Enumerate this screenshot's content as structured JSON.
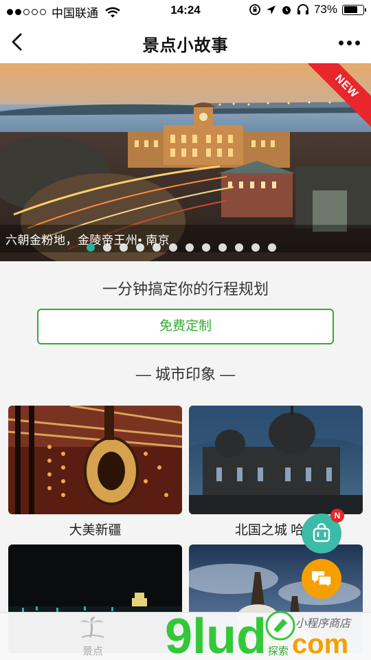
{
  "status_bar": {
    "carrier": "中国联通",
    "time": "14:24",
    "battery": "73%",
    "battery_level": 0.73
  },
  "nav": {
    "title": "景点小故事",
    "back_icon": "chevron-left-icon",
    "more_icon": "more-horizontal-icon"
  },
  "banner": {
    "caption": "六朝金粉地，金陵帝王州• 南京",
    "ribbon": "NEW",
    "slide_count": 12,
    "active_index": 0
  },
  "plan": {
    "title": "一分钟搞定你的行程规划",
    "button": "免费定制"
  },
  "city_section": {
    "title": "— 城市印象 —",
    "cards": [
      {
        "label": "大美新疆",
        "image": "xinjiang-instrument-photo"
      },
      {
        "label": "北国之城 哈尔",
        "image": "harbin-cathedral-photo"
      },
      {
        "label": "",
        "image": "night-city-photo"
      },
      {
        "label": "",
        "image": "tibetan-stupa-photo"
      }
    ]
  },
  "fabs": {
    "bag_icon": "shopping-bag-icon",
    "chat_icon": "chat-bubbles-icon",
    "badge": "N"
  },
  "tabbar": {
    "items": [
      {
        "label": "景点",
        "icon": "palm-tree-icon"
      },
      {
        "label": "探索",
        "icon": "compass-icon"
      }
    ]
  },
  "watermark": {
    "text": "9lud",
    "suffix": "com",
    "script": "小程序商店"
  },
  "colors": {
    "accent_green": "#2fac2f",
    "teal": "#3cbba9",
    "orange": "#f5a000",
    "badge_red": "#e8262b"
  }
}
